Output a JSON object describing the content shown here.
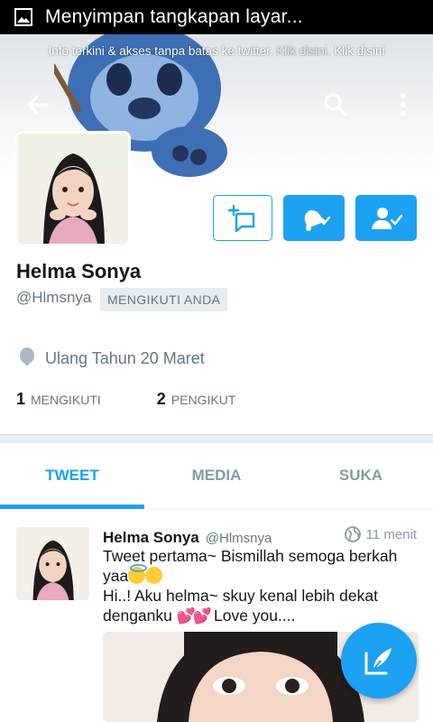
{
  "status_bar": {
    "text": "Menyimpan tangkapan layar..."
  },
  "banner": {
    "notice_main": "Info terkini & akses tanpa batas ke twitter.",
    "notice_link_1": "Klik disini.",
    "notice_link_2": "Klik disini"
  },
  "header": {
    "back_icon": "arrow-left-icon",
    "search_icon": "search-icon",
    "more_icon": "more-vertical-icon"
  },
  "profile": {
    "name": "Helma Sonya",
    "handle": "@Hlmsnya",
    "follows_you": "MENGIKUTI ANDA",
    "birthday": "Ulang Tahun 20 Maret",
    "following_count": "1",
    "following_label": "MENGIKUTI",
    "followers_count": "2",
    "followers_label": "PENGIKUT"
  },
  "actions": {
    "dm_icon": "direct-message-icon",
    "notifications_icon": "bell-check-icon",
    "follow_icon": "user-check-icon"
  },
  "tabs": [
    {
      "label": "TWEET",
      "active": true
    },
    {
      "label": "MEDIA",
      "active": false
    },
    {
      "label": "SUKA",
      "active": false
    }
  ],
  "tweet": {
    "name": "Helma Sonya",
    "handle": "@Hlmsnya",
    "time": "11 menit",
    "line1": "Tweet pertama~ Bismillah semoga berkah yaa",
    "line2": "Hi..! Aku helma~ skuy kenal lebih dekat denganku",
    "line3": "Love you...."
  },
  "fab": {
    "icon": "compose-tweet-icon"
  },
  "colors": {
    "accent": "#1da1f2",
    "muted": "#657786",
    "divider": "#e6ecf0"
  }
}
